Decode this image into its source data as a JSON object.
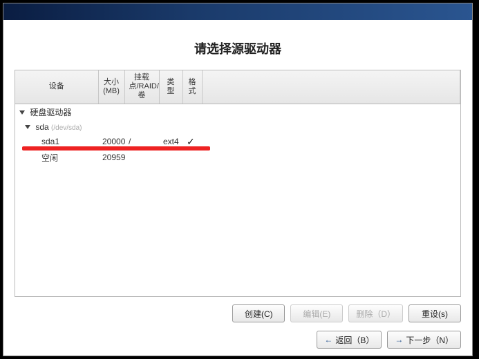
{
  "title": "请选择源驱动器",
  "columns": {
    "device": "设备",
    "size": "大小(MB)",
    "mount": "挂载点/RAID/卷",
    "type": "类型",
    "format": "格式"
  },
  "tree": {
    "root": {
      "label": "硬盘驱动器"
    },
    "disk": {
      "name": "sda",
      "path": "(/dev/sda)"
    },
    "partitions": [
      {
        "name": "sda1",
        "size": "20000",
        "mount": "/",
        "type": "ext4",
        "checked": true
      },
      {
        "name": "空闲",
        "size": "20959",
        "mount": "",
        "type": "",
        "checked": false
      }
    ]
  },
  "buttons": {
    "create": "创建(C)",
    "edit": "编辑(E)",
    "delete": "删除（D）",
    "reset": "重设(s)",
    "back": "返回（B）",
    "next": "下一步（N）"
  }
}
